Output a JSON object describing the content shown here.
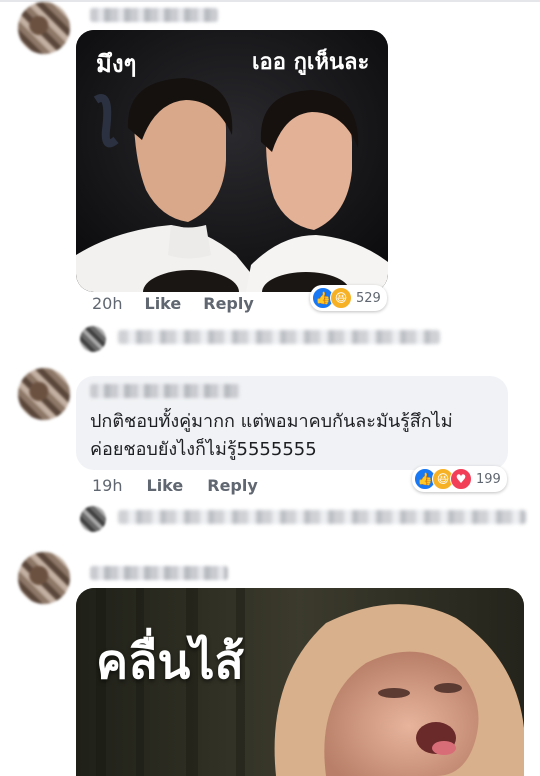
{
  "comments": [
    {
      "meme_caption_left": "มึงๆ",
      "meme_caption_right": "เออ กูเห็นละ",
      "time": "20h",
      "like": "Like",
      "reply": "Reply",
      "reaction_count": "529"
    },
    {
      "text_line1": "ปกติชอบทั้งคู่มากก แต่พอมาคบกันละมันรู้สึกไม่",
      "text_line2": "ค่อยชอบยังไงก็ไม่รู้5555555",
      "time": "19h",
      "like": "Like",
      "reply": "Reply",
      "reaction_count": "199"
    },
    {
      "meme_caption": "คลื่นไส้"
    }
  ],
  "icons": [
    "thumbs-up-icon",
    "haha-icon",
    "love-icon"
  ],
  "colors": {
    "like": "#1877f2",
    "haha": "#f7b125",
    "love": "#f33e58",
    "meta": "#606770",
    "bubble": "#f0f2f5"
  }
}
